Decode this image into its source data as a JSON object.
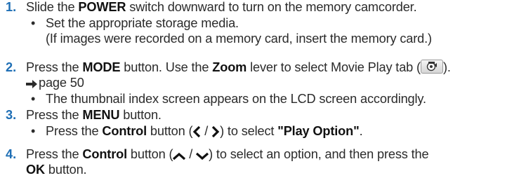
{
  "steps": [
    {
      "number": "1.",
      "parts": {
        "a": "Slide the ",
        "b": "POWER",
        "c": " switch downward to turn on the memory camcorder."
      },
      "bullets": [
        "Set the appropriate storage media.",
        "(If images were recorded on a memory card, insert the memory card.)"
      ]
    },
    {
      "number": "2.",
      "parts": {
        "a": "Press the ",
        "b": "MODE",
        "c": " button. Use the ",
        "d": "Zoom",
        "e": " lever to select Movie Play tab (",
        "f": ")."
      },
      "page_ref": "page 50",
      "bullets": [
        "The thumbnail index screen appears on the LCD screen accordingly."
      ]
    },
    {
      "number": "3.",
      "parts": {
        "a": "Press the ",
        "b": "MENU",
        "c": " button."
      },
      "bullets": [
        {
          "a": "Press the ",
          "b": "Control",
          "c": " button (",
          "sep": " / ",
          "d": ") to select ",
          "e": "\"Play Option\"",
          "f": "."
        }
      ]
    },
    {
      "number": "4.",
      "parts": {
        "a": "Press the ",
        "b": "Control",
        "c": " button (",
        "sep": " / ",
        "d": ") to select an option, and then press the",
        "e": "OK",
        "f": " button."
      }
    }
  ],
  "icons": {
    "movie_play_tab": "movie-play-tab-icon",
    "page_arrow": "arrow-right-icon",
    "left": "chevron-left-icon",
    "right": "chevron-right-icon",
    "up": "chevron-up-icon",
    "down": "chevron-down-icon"
  },
  "colors": {
    "step_number": "#1f6fb5",
    "text": "#2b2b2b"
  }
}
